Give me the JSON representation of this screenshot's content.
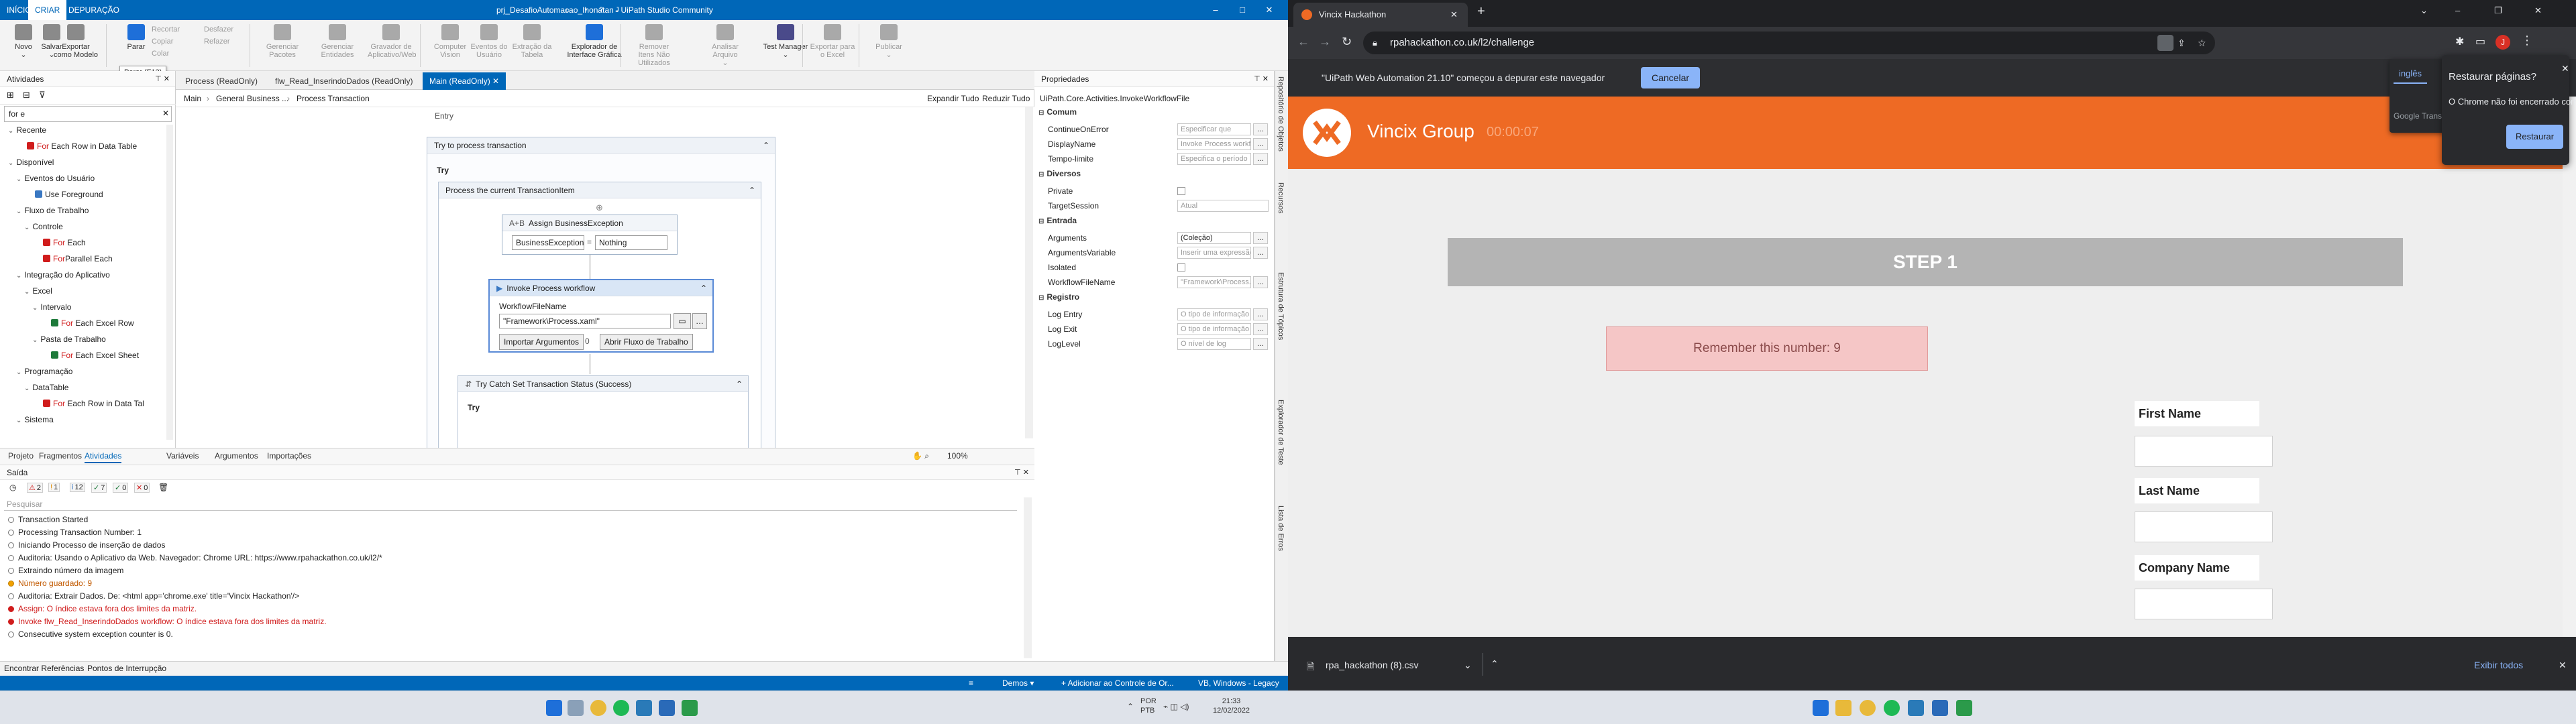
{
  "studio": {
    "title": "prj_DesafioAutomacao_Ihonatan - UiPath Studio Community",
    "menu_tabs": [
      "INÍCIO",
      "CRIAR",
      "DEPURAÇÃO"
    ],
    "window_controls": [
      "–",
      "□",
      "✕"
    ],
    "ribbon": {
      "buttons": [
        {
          "label": "Novo",
          "sub": "⌄",
          "color": "#8a8a8a",
          "disabled": false
        },
        {
          "label": "Salvar",
          "sub": "⌄",
          "color": "#8a8a8a",
          "disabled": false
        },
        {
          "label": "Exportar como Modelo",
          "sub": "",
          "color": "#8a8a8a",
          "disabled": false
        },
        {
          "label": "Parar",
          "sub": "",
          "color": "#1e6fd9",
          "disabled": false
        },
        {
          "label": "Gerenciar Pacotes",
          "sub": "",
          "color": "#a9a9a9",
          "disabled": true
        },
        {
          "label": "Gerenciar Entidades",
          "sub": "",
          "color": "#a9a9a9",
          "disabled": true
        },
        {
          "label": "Gravador de Aplicativo/Web",
          "sub": "",
          "color": "#a9a9a9",
          "disabled": true
        },
        {
          "label": "Computer Vision",
          "sub": "",
          "color": "#a9a9a9",
          "disabled": true
        },
        {
          "label": "Eventos do Usuário",
          "sub": "",
          "color": "#a9a9a9",
          "disabled": true
        },
        {
          "label": "Extração da Tabela",
          "sub": "",
          "color": "#a9a9a9",
          "disabled": true
        },
        {
          "label": "Explorador de Interface Gráfica",
          "sub": "",
          "color": "#1e6fd9",
          "disabled": false
        },
        {
          "label": "Remover Itens Não Utilizados",
          "sub": "⌄",
          "color": "#a9a9a9",
          "disabled": true
        },
        {
          "label": "Analisar Arquivo",
          "sub": "⌄",
          "color": "#a9a9a9",
          "disabled": true
        },
        {
          "label": "Test Manager",
          "sub": "⌄",
          "color": "#4a4a8a",
          "disabled": false
        },
        {
          "label": "Exportar para o Excel",
          "sub": "",
          "color": "#a9a9a9",
          "disabled": true
        },
        {
          "label": "Publicar",
          "sub": "⌄",
          "color": "#a9a9a9",
          "disabled": true
        }
      ],
      "clipboard": [
        "Recortar",
        "Copiar",
        "Colar"
      ],
      "undo": [
        "Desfazer",
        "Refazer"
      ]
    },
    "tooltip": "Parar (F12)",
    "activities": {
      "header": "Atividades",
      "search": "for e",
      "tree": [
        {
          "label": "Recente",
          "level": 0,
          "red": ""
        },
        {
          "label": " Each Row in Data Table",
          "level": 2,
          "red": "For",
          "icon": "#d01c1c"
        },
        {
          "label": "Disponível",
          "level": 0,
          "red": ""
        },
        {
          "label": "Eventos do Usuário",
          "level": 1,
          "red": ""
        },
        {
          "label": "Use Foreground",
          "level": 3,
          "red": "",
          "icon": "#3a78c2"
        },
        {
          "label": "Fluxo de Trabalho",
          "level": 1,
          "red": ""
        },
        {
          "label": "Controle",
          "level": 2,
          "red": ""
        },
        {
          "label": " Each",
          "level": 4,
          "red": "For",
          "icon": "#d01c1c"
        },
        {
          "label": "Parallel  Each",
          "level": 4,
          "red": "For",
          "icon": "#d01c1c"
        },
        {
          "label": "Integração do Aplicativo",
          "level": 1,
          "red": ""
        },
        {
          "label": "Excel",
          "level": 2,
          "red": ""
        },
        {
          "label": "Intervalo",
          "level": 3,
          "red": ""
        },
        {
          "label": " Each Excel Row",
          "level": 5,
          "red": "For",
          "icon": "#1d7a3a"
        },
        {
          "label": "Pasta de Trabalho",
          "level": 3,
          "red": ""
        },
        {
          "label": " Each Excel Sheet",
          "level": 5,
          "red": "For",
          "icon": "#1d7a3a"
        },
        {
          "label": "Programação",
          "level": 1,
          "red": ""
        },
        {
          "label": "DataTable",
          "level": 2,
          "red": ""
        },
        {
          "label": " Each Row in Data Tal",
          "level": 4,
          "red": "For",
          "icon": "#d01c1c"
        },
        {
          "label": "Sistema",
          "level": 1,
          "red": ""
        }
      ]
    },
    "doc_tabs": [
      {
        "label": "Process (ReadOnly)",
        "active": false
      },
      {
        "label": "flw_Read_InserindoDados (ReadOnly)",
        "active": false
      },
      {
        "label": "Main (ReadOnly)  ✕",
        "active": true
      }
    ],
    "breadcrumb": [
      "Main",
      "General Business ...",
      "Process Transaction"
    ],
    "expand_all": "Expandir Tudo",
    "collapse_all": "Reduzir Tudo",
    "canvas": {
      "entry": "Entry",
      "try_process": "Try to process transaction",
      "try_label": "Try",
      "process_current": "Process the current TransactionItem",
      "assign_title": "Assign BusinessException",
      "assign_left": "BusinessException",
      "assign_op": "=",
      "assign_right": "Nothing",
      "invoke_title": "Invoke Process workflow",
      "workflow_label": "WorkflowFileName",
      "workflow_value": "\"Framework\\Process.xaml\"",
      "import_args": "Importar Argumentos",
      "import_count": "0",
      "open_workflow": "Abrir Fluxo de Trabalho",
      "try_catch": "Try Catch Set Transaction Status (Success)",
      "try_label2": "Try"
    },
    "zoom": "100%",
    "properties": {
      "header": "Propriedades",
      "type": "UiPath.Core.Activities.InvokeWorkflowFile",
      "categories": [
        {
          "name": "Comum",
          "rows": [
            {
              "name": "ContinueOnError",
              "value": "Especificar que"
            },
            {
              "name": "DisplayName",
              "value": "Invoke Process workflow"
            },
            {
              "name": "Tempo-limite",
              "value": "Especifica o período"
            }
          ]
        },
        {
          "name": "Diversos",
          "rows": [
            {
              "name": "Private",
              "value": "",
              "checkbox": true
            },
            {
              "name": "TargetSession",
              "value": "Atual",
              "dropdown": true
            }
          ]
        },
        {
          "name": "Entrada",
          "rows": [
            {
              "name": "Arguments",
              "value": "(Coleção)",
              "solid": true
            },
            {
              "name": "ArgumentsVariable",
              "value": "Inserir uma expressão"
            },
            {
              "name": "Isolated",
              "value": "",
              "checkbox": true
            },
            {
              "name": "WorkflowFileName",
              "value": "\"Framework\\Process.xaml\""
            }
          ]
        },
        {
          "name": "Registro",
          "rows": [
            {
              "name": "Log Entry",
              "value": "O tipo de informação"
            },
            {
              "name": "Log Exit",
              "value": "O tipo de informação"
            },
            {
              "name": "LogLevel",
              "value": "O nível de log"
            }
          ]
        }
      ]
    },
    "side_strip": [
      "Repositório de Objetos",
      "Recursos",
      "Estrutura de Tópicos",
      "Explorador de Teste",
      "Lista de Erros"
    ],
    "bottom_tabs": [
      "Projeto",
      "Fragmentos",
      "Atividades",
      "Variáveis",
      "Argumentos",
      "Importações"
    ],
    "output": {
      "header": "Saída",
      "filters": [
        {
          "icon": "⚠",
          "count": "2",
          "color": "#d01c1c"
        },
        {
          "icon": "!",
          "count": "1",
          "color": "#e08a00"
        },
        {
          "icon": "i",
          "count": "12",
          "color": "#3a78c2"
        },
        {
          "icon": "✓",
          "count": "7",
          "color": "#1d7a3a"
        },
        {
          "icon": "✓",
          "count": "0",
          "color": "#1d7a3a"
        },
        {
          "icon": "✕",
          "count": "0",
          "color": "#d01c1c"
        }
      ],
      "search_placeholder": "Pesquisar",
      "logs": [
        {
          "text": "Transaction Started",
          "level": "info"
        },
        {
          "text": "Processing Transaction Number: 1",
          "level": "info"
        },
        {
          "text": "Iniciando Processo de inserção de dados",
          "level": "info"
        },
        {
          "text": "Auditoria: Usando o Aplicativo da Web. Navegador: Chrome URL: https://www.rpahackathon.co.uk/l2/*",
          "level": "info"
        },
        {
          "text": "Extraindo número da imagem",
          "level": "info"
        },
        {
          "text": "Número guardado: 9",
          "level": "warn"
        },
        {
          "text": "Auditoria: Extrair Dados. De: <html app='chrome.exe' title='Vincix Hackathon'/>",
          "level": "info"
        },
        {
          "text": "Assign: O índice estava fora dos limites da matriz.",
          "level": "err"
        },
        {
          "text": "Invoke flw_Read_InserindoDados workflow: O índice estava fora dos limites da matriz.",
          "level": "err"
        },
        {
          "text": "Consecutive system exception counter is 0.",
          "level": "info"
        }
      ]
    },
    "bottom_bar": [
      "Encontrar Referências",
      "Pontos de Interrupção"
    ],
    "status": {
      "demos": "Demos ▾",
      "source": "+ Adicionar ao Controle de Or...",
      "version": "VB, Windows - Legacy"
    }
  },
  "taskbar_left": {
    "lang": "POR",
    "layout": "PTB",
    "time": "21:33",
    "date": "12/02/2022"
  },
  "chrome": {
    "tab_title": "Vincix Hackathon",
    "url": "rpahackathon.co.uk/l2/challenge",
    "infobar_text": "\"UiPath Web Automation 21.10\" começou a depurar este navegador",
    "infobar_cancel": "Cancelar",
    "translate": {
      "lang1": "inglês",
      "lang2": "po",
      "brand": "Google Translate"
    },
    "restore": {
      "title": "Restaurar páginas?",
      "message": "O Chrome não foi encerrado corretamente.",
      "button": "Restaurar"
    },
    "page": {
      "brand": "Vincix Group",
      "timer": "00:00:07",
      "step": "STEP 1",
      "remember": "Remember this number: 9",
      "fields": [
        "First Name",
        "Last Name",
        "Company Name"
      ]
    },
    "download": {
      "file": "rpa_hackathon (8).csv",
      "show_all": "Exibir todos"
    }
  },
  "colors": {
    "uipath_blue": "#0067b8",
    "vincix_orange": "#ee6a24",
    "remember_bg": "#f5c6c6",
    "step_bg": "#b4b4b4"
  }
}
